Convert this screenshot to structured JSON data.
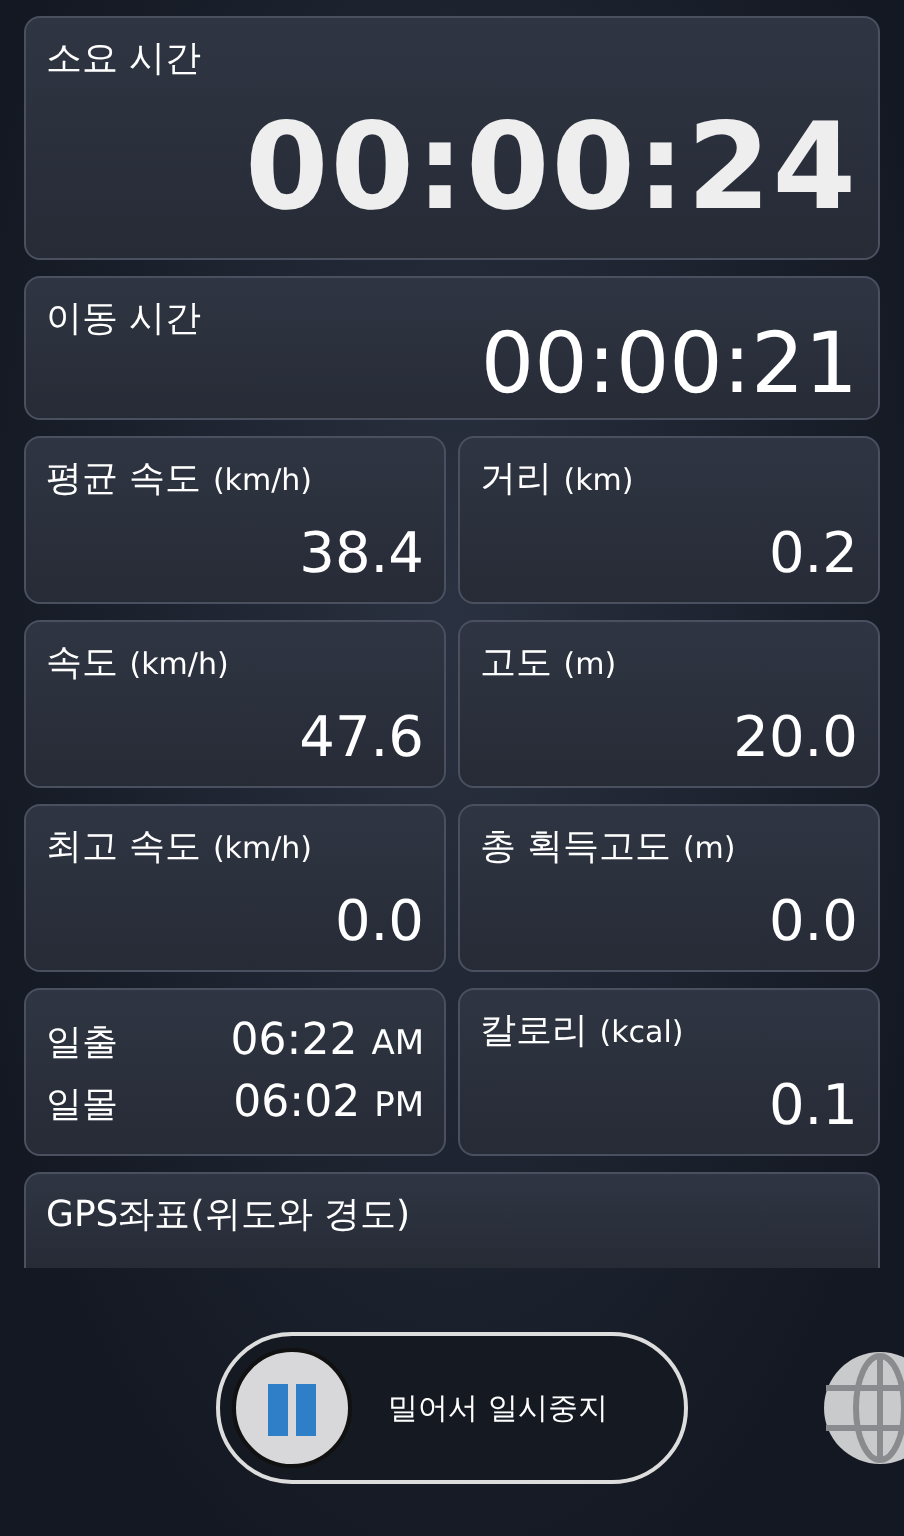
{
  "elapsed": {
    "label": "소요 시간",
    "value": "00:00:24"
  },
  "moving": {
    "label": "이동 시간",
    "value": "00:00:21"
  },
  "stats": [
    {
      "kind": "metric",
      "label": "평균 속도",
      "unit": "(km/h)",
      "value": "38.4"
    },
    {
      "kind": "metric",
      "label": "거리",
      "unit": "(km)",
      "value": "0.2"
    },
    {
      "kind": "metric",
      "label": "속도",
      "unit": "(km/h)",
      "value": "47.6"
    },
    {
      "kind": "metric",
      "label": "고도",
      "unit": "(m)",
      "value": "20.0"
    },
    {
      "kind": "metric",
      "label": "최고 속도",
      "unit": "(km/h)",
      "value": "0.0"
    },
    {
      "kind": "metric",
      "label": "총 획득고도",
      "unit": "(m)",
      "value": "0.0"
    },
    {
      "kind": "sun",
      "rows": [
        {
          "label": "일출",
          "time": "06:22",
          "ampm": "AM"
        },
        {
          "label": "일몰",
          "time": "06:02",
          "ampm": "PM"
        }
      ]
    },
    {
      "kind": "metric",
      "label": "칼로리",
      "unit": "(kcal)",
      "value": "0.1"
    }
  ],
  "gps": {
    "label": "GPS좌표(위도와 경도)"
  },
  "pause_slider": {
    "label": "밀어서 일시중지",
    "level": 0
  }
}
